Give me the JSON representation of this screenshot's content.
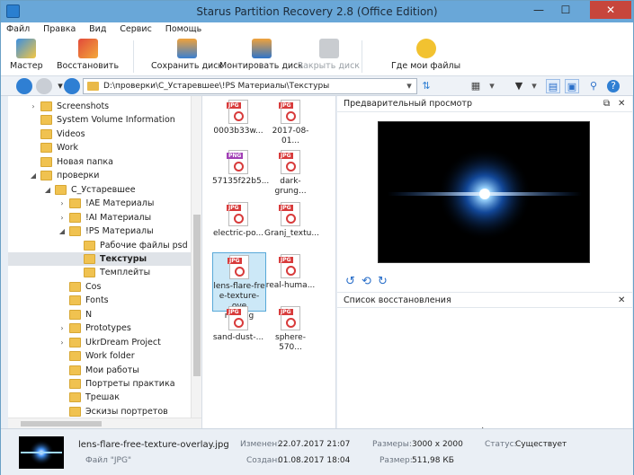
{
  "window": {
    "title": "Starus Partition Recovery 2.8 (Office Edition)",
    "min_icon": "—",
    "max_icon": "☐",
    "close_icon": "✕"
  },
  "menu": [
    "Файл",
    "Правка",
    "Вид",
    "Сервис",
    "Помощь"
  ],
  "toolbar": {
    "wizard": "Мастер",
    "restore": "Восстановить",
    "save_disk": "Сохранить диск",
    "mount_disk": "Монтировать диск",
    "close_disk": "Закрыть диск",
    "where_files": "Где мои файлы"
  },
  "address": {
    "path": "D:\\проверки\\С_Устаревшее\\!PS Материалы\\Текстуры"
  },
  "tree": {
    "items": [
      {
        "label": "Screenshots",
        "level": 1,
        "expander": "›"
      },
      {
        "label": "System Volume Information",
        "level": 1,
        "expander": ""
      },
      {
        "label": "Videos",
        "level": 1,
        "expander": ""
      },
      {
        "label": "Work",
        "level": 1,
        "expander": ""
      },
      {
        "label": "Новая папка",
        "level": 1,
        "expander": ""
      },
      {
        "label": "проверки",
        "level": 1,
        "expander": "◢"
      },
      {
        "label": "С_Устаревшее",
        "level": 2,
        "expander": "◢"
      },
      {
        "label": "!AE Материалы",
        "level": 3,
        "expander": "›"
      },
      {
        "label": "!AI Материалы",
        "level": 3,
        "expander": "›"
      },
      {
        "label": "!PS Материалы",
        "level": 3,
        "expander": "◢"
      },
      {
        "label": "Рабочие файлы psd",
        "level": 4,
        "expander": ""
      },
      {
        "label": "Текстуры",
        "level": 4,
        "expander": "",
        "selected": true
      },
      {
        "label": "Темплейты",
        "level": 4,
        "expander": ""
      },
      {
        "label": "Cos",
        "level": 3,
        "expander": ""
      },
      {
        "label": "Fonts",
        "level": 3,
        "expander": ""
      },
      {
        "label": "N",
        "level": 3,
        "expander": ""
      },
      {
        "label": "Prototypes",
        "level": 3,
        "expander": "›"
      },
      {
        "label": "UkrDream Project",
        "level": 3,
        "expander": "›"
      },
      {
        "label": "Work folder",
        "level": 3,
        "expander": ""
      },
      {
        "label": "Мои работы",
        "level": 3,
        "expander": ""
      },
      {
        "label": "Портреты практика",
        "level": 3,
        "expander": ""
      },
      {
        "label": "Трешак",
        "level": 3,
        "expander": ""
      },
      {
        "label": "Эскизы портретов",
        "level": 3,
        "expander": ""
      }
    ]
  },
  "files": [
    {
      "name": "0003b33w...",
      "type": "JPG"
    },
    {
      "name": "2017-08-01...",
      "type": "JPG"
    },
    {
      "name": "57135f22b5...",
      "type": "PNG"
    },
    {
      "name": "dark-grung...",
      "type": "JPG"
    },
    {
      "name": "electric-po...",
      "type": "JPG"
    },
    {
      "name": "Granj_textu...",
      "type": "JPG"
    },
    {
      "name": "lens-flare-texture-overlay.jpg",
      "name_lines": [
        "lens-flare-fre",
        "e-texture-ove",
        "rlay.jpg"
      ],
      "type": "JPG",
      "selected": true
    },
    {
      "name": "real-huma...",
      "type": "JPG"
    },
    {
      "name": "sand-dust-...",
      "type": "JPG"
    },
    {
      "name": "sphere-570...",
      "type": "JPG"
    }
  ],
  "preview": {
    "title": "Предварительный просмотр",
    "pin_icon": "⧉",
    "close_icon": "✕"
  },
  "restore_list": {
    "title": "Список восстановления",
    "close_icon": "✕"
  },
  "rotate": {
    "left_icon": "↺",
    "flip_icon": "⟲",
    "right_icon": "↻"
  },
  "status": {
    "filename": "lens-flare-free-texture-overlay.jpg",
    "filetype": "Файл \"JPG\"",
    "modified_label": "Изменен:",
    "modified": "22.07.2017 21:07",
    "created_label": "Создан:",
    "created": "01.08.2017 18:04",
    "dims_label": "Размеры:",
    "dims": "3000 x 2000",
    "size_label": "Размер:",
    "size": "511,98 КБ",
    "state_label": "Статус:",
    "state": "Существует"
  },
  "colors": {
    "titlebar": "#69a7d8",
    "selection": "#cce8f7",
    "folder": "#f0c250",
    "accent": "#2a7fd0"
  }
}
